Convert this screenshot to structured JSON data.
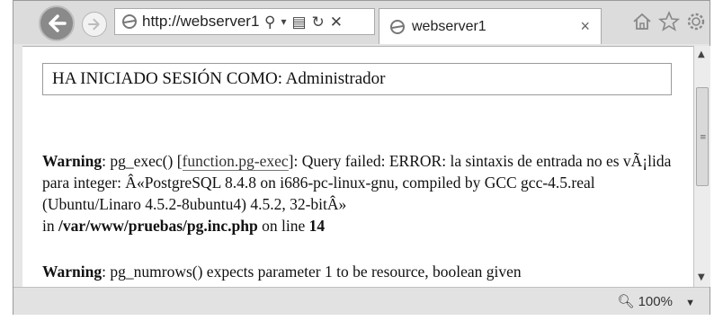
{
  "browser": {
    "address_url": "http://webserver1",
    "address_icons": {
      "search": "⚲",
      "dropdown": "▾",
      "compat": "▤",
      "refresh": "↻",
      "stop": "✕"
    },
    "tab": {
      "title": "webserver1",
      "close": "×"
    },
    "toolbar_icons": [
      "home-icon",
      "star-icon",
      "gear-icon"
    ]
  },
  "page": {
    "logged_in_label": "HA INICIADO SESIÓN COMO: Administrador",
    "warning1": {
      "label": "Warning",
      "text_before_link": ": pg_exec() [",
      "link": "function.pg-exec",
      "text_after_link": "]: Query failed: ERROR: la sintaxis de entrada no es vÃ¡lida para integer: Â«PostgreSQL 8.4.8 on i686-pc-linux-gnu, compiled by GCC gcc-4.5.real (Ubuntu/Linaro 4.5.2-8ubuntu4) 4.5.2, 32-bitÂ»",
      "in_label": "in",
      "file": "/var/www/pruebas/pg.inc.php",
      "on_line_label": "on line",
      "line": "14"
    },
    "warning2": {
      "label": "Warning",
      "text": ": pg_numrows() expects parameter 1 to be resource, boolean given"
    }
  },
  "statusbar": {
    "zoom": "100%"
  },
  "colors": {
    "back_button": "#8a8a8a",
    "chrome": "#dcdcdc"
  }
}
